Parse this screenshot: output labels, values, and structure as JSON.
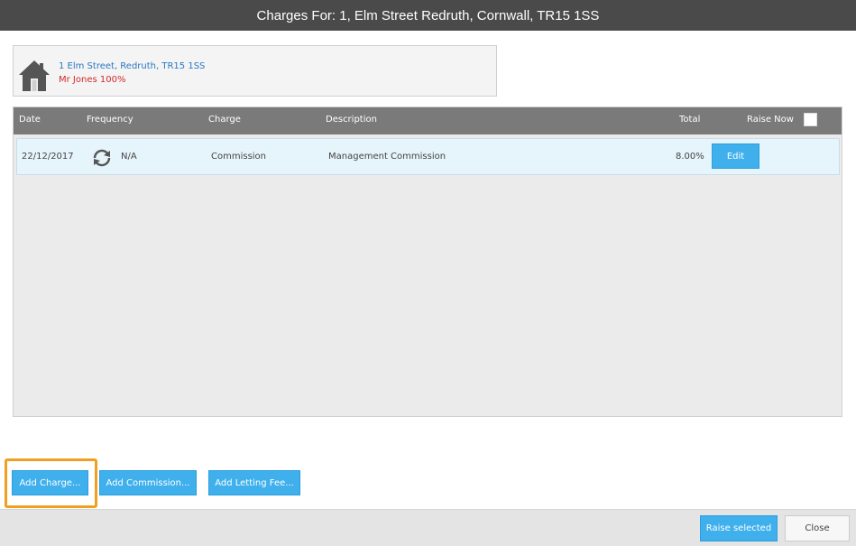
{
  "window": {
    "title": "Charges For: 1, Elm Street Redruth, Cornwall, TR15 1SS"
  },
  "property": {
    "address": "1 Elm Street, Redruth, TR15 1SS",
    "owner": "Mr Jones 100%",
    "icon": "house-icon"
  },
  "table": {
    "columns": {
      "date": "Date",
      "frequency": "Frequency",
      "charge": "Charge",
      "description": "Description",
      "total": "Total",
      "raise_now": "Raise Now"
    },
    "rows": [
      {
        "date": "22/12/2017",
        "frequency_icon": "recurring-icon",
        "frequency": "N/A",
        "charge": "Commission",
        "description": "Management Commission",
        "total": "8.00%",
        "edit_label": "Edit"
      }
    ]
  },
  "actions": {
    "add_charge": "Add Charge...",
    "add_commission": "Add Commission...",
    "add_letting_fee": "Add Letting Fee..."
  },
  "footer": {
    "raise_selected": "Raise selected",
    "close": "Close"
  },
  "colors": {
    "titlebar": "#4a4a4a",
    "accent": "#3fb0ec",
    "highlight": "#f0a020",
    "address_link": "#2a78c2",
    "owner_text": "#d22a2a"
  }
}
